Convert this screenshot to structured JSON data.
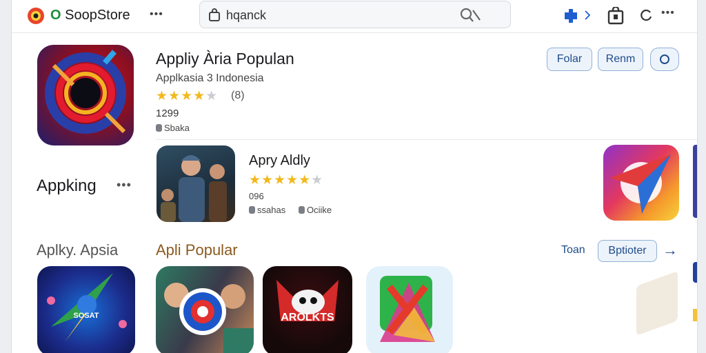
{
  "header": {
    "brand_part1": "O",
    "brand_part2": "SoopStore",
    "menu_dots": "•••",
    "search": {
      "value": "hqanck"
    }
  },
  "featured": {
    "name": "Appking",
    "title": "Appliy Ària Populan",
    "subtitle": "Applkasia 3 Indonesia",
    "rating": 4,
    "rating_count": "(8)",
    "price": "1299",
    "meta": "Sbaka",
    "buttons": {
      "b1": "Folar",
      "b2": "Renm"
    }
  },
  "list_item": {
    "title": "Apry Aldly",
    "rating": 4.5,
    "number": "096",
    "meta1": "ssahas",
    "meta2": "Ociike"
  },
  "section": {
    "left_title": "Aplky. Apsia",
    "title": "Apli Popular",
    "link": "Toan",
    "button": "Bptioter",
    "arrow": "→",
    "tiles": [
      {
        "label": "SOSAT"
      },
      {
        "label": ""
      },
      {
        "label": "AROLKTS"
      },
      {
        "label": ""
      }
    ]
  },
  "colors": {
    "accent": "#1e4c8a",
    "star": "#f2b91c",
    "section_title": "#8b5a1e"
  }
}
